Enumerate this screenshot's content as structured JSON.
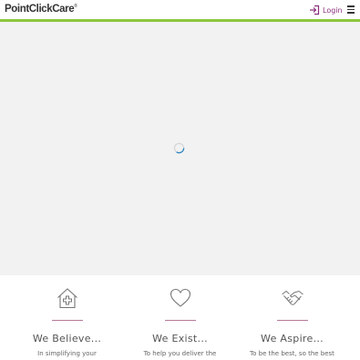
{
  "header": {
    "logo_text": "PointClickCare",
    "logo_mark": "®",
    "login_label": "Login",
    "login_icon": "login-arrow-icon",
    "menu_icon": "hamburger-menu-icon",
    "accent_color": "#8cc63e",
    "brand_color": "#8a2f7c"
  },
  "hero": {
    "status": "loading",
    "spinner_icon": "loading-spinner-icon",
    "background_color": "#f2f2f2"
  },
  "values": [
    {
      "icon": "house-plus-icon",
      "title": "We Believe...",
      "text": "In simplifying your"
    },
    {
      "icon": "heart-icon",
      "title": "We Exist...",
      "text": "To help you deliver the"
    },
    {
      "icon": "handshake-icon",
      "title": "We Aspire...",
      "text": "To be the best, so the best"
    }
  ]
}
